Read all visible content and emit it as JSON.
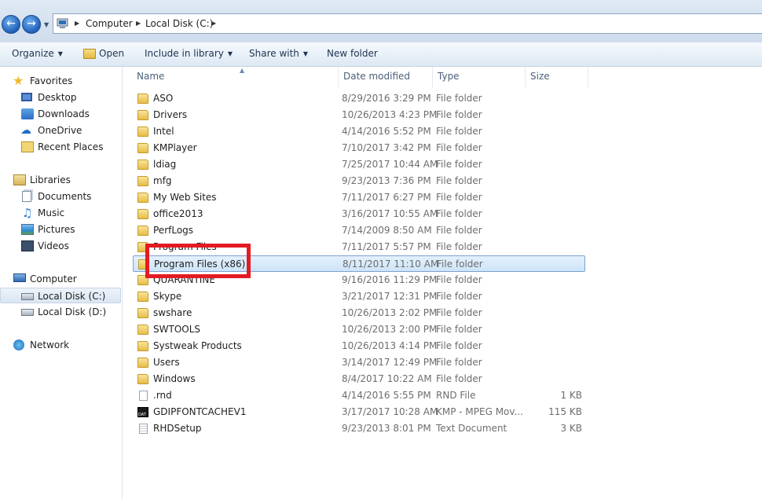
{
  "address": {
    "crumbs": [
      "Computer",
      "Local Disk (C:)"
    ]
  },
  "toolbar": {
    "organize": "Organize",
    "open": "Open",
    "include": "Include in library",
    "share": "Share with",
    "new_folder": "New folder"
  },
  "nav": {
    "favorites": "Favorites",
    "desktop": "Desktop",
    "downloads": "Downloads",
    "onedrive": "OneDrive",
    "recent": "Recent Places",
    "libraries": "Libraries",
    "documents": "Documents",
    "music": "Music",
    "pictures": "Pictures",
    "videos": "Videos",
    "computer": "Computer",
    "local_c": "Local Disk (C:)",
    "local_d": "Local Disk (D:)",
    "network": "Network"
  },
  "columns": {
    "name": "Name",
    "date": "Date modified",
    "type": "Type",
    "size": "Size"
  },
  "files": [
    {
      "name": "ASO",
      "date": "8/29/2016 3:29 PM",
      "type": "File folder",
      "size": "",
      "icon": "folder-icon"
    },
    {
      "name": "Drivers",
      "date": "10/26/2013 4:23 PM",
      "type": "File folder",
      "size": "",
      "icon": "folder-icon"
    },
    {
      "name": "Intel",
      "date": "4/14/2016 5:52 PM",
      "type": "File folder",
      "size": "",
      "icon": "folder-icon"
    },
    {
      "name": "KMPlayer",
      "date": "7/10/2017 3:42 PM",
      "type": "File folder",
      "size": "",
      "icon": "folder-icon"
    },
    {
      "name": "ldiag",
      "date": "7/25/2017 10:44 AM",
      "type": "File folder",
      "size": "",
      "icon": "folder-icon"
    },
    {
      "name": "mfg",
      "date": "9/23/2013 7:36 PM",
      "type": "File folder",
      "size": "",
      "icon": "folder-icon"
    },
    {
      "name": "My Web Sites",
      "date": "7/11/2017 6:27 PM",
      "type": "File folder",
      "size": "",
      "icon": "folder-icon"
    },
    {
      "name": "office2013",
      "date": "3/16/2017 10:55 AM",
      "type": "File folder",
      "size": "",
      "icon": "folder-icon"
    },
    {
      "name": "PerfLogs",
      "date": "7/14/2009 8:50 AM",
      "type": "File folder",
      "size": "",
      "icon": "folder-icon"
    },
    {
      "name": "Program Files",
      "date": "7/11/2017 5:57 PM",
      "type": "File folder",
      "size": "",
      "icon": "folder-icon"
    },
    {
      "name": "Program Files (x86)",
      "date": "8/11/2017 11:10 AM",
      "type": "File folder",
      "size": "",
      "icon": "folder-icon",
      "selected": true
    },
    {
      "name": "QUARANTINE",
      "date": "9/16/2016 11:29 PM",
      "type": "File folder",
      "size": "",
      "icon": "folder-icon"
    },
    {
      "name": "Skype",
      "date": "3/21/2017 12:31 PM",
      "type": "File folder",
      "size": "",
      "icon": "folder-icon"
    },
    {
      "name": "swshare",
      "date": "10/26/2013 2:02 PM",
      "type": "File folder",
      "size": "",
      "icon": "folder-icon"
    },
    {
      "name": "SWTOOLS",
      "date": "10/26/2013 2:00 PM",
      "type": "File folder",
      "size": "",
      "icon": "folder-icon"
    },
    {
      "name": "Systweak Products",
      "date": "10/26/2013 4:14 PM",
      "type": "File folder",
      "size": "",
      "icon": "folder-icon"
    },
    {
      "name": "Users",
      "date": "3/14/2017 12:49 PM",
      "type": "File folder",
      "size": "",
      "icon": "folder-icon"
    },
    {
      "name": "Windows",
      "date": "8/4/2017 10:22 AM",
      "type": "File folder",
      "size": "",
      "icon": "folder-icon"
    },
    {
      "name": ".rnd",
      "date": "4/14/2016 5:55 PM",
      "type": "RND File",
      "size": "1 KB",
      "icon": "file-icon"
    },
    {
      "name": "GDIPFONTCACHEV1",
      "date": "3/17/2017 10:28 AM",
      "type": "KMP - MPEG Mov...",
      "size": "115 KB",
      "icon": "dat-file-icon"
    },
    {
      "name": "RHDSetup",
      "date": "9/23/2013 8:01 PM",
      "type": "Text Document",
      "size": "3 KB",
      "icon": "text-file-icon"
    }
  ]
}
